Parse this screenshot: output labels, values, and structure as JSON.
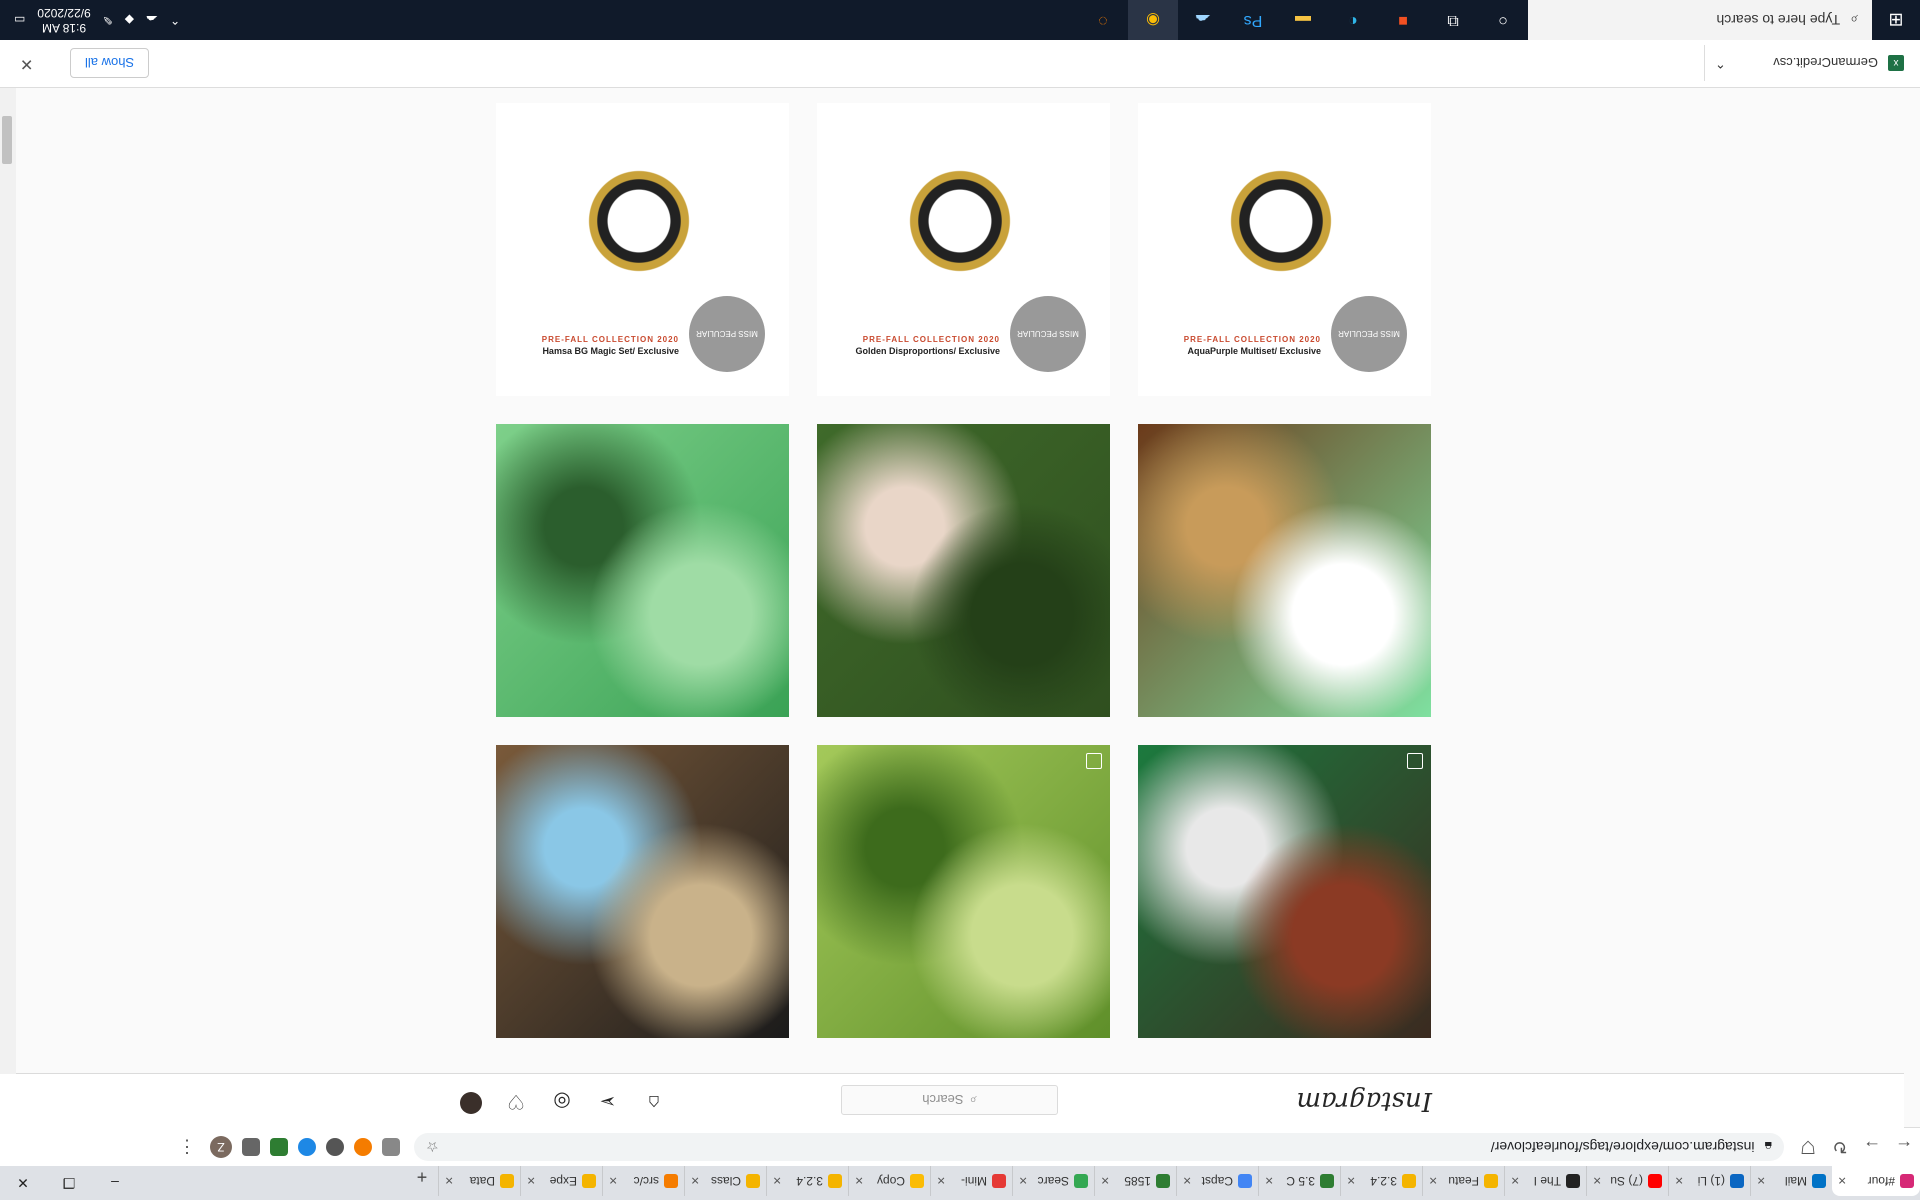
{
  "browser": {
    "tabs": [
      {
        "label": "#four",
        "color": "#d62976",
        "active": true
      },
      {
        "label": "Mail",
        "color": "#0072c6"
      },
      {
        "label": "(1) Li",
        "color": "#0a66c2"
      },
      {
        "label": "(7) Su",
        "color": "#ff0000"
      },
      {
        "label": "The I",
        "color": "#222222"
      },
      {
        "label": "Featu",
        "color": "#f4b400"
      },
      {
        "label": "3.2.4",
        "color": "#f4b400"
      },
      {
        "label": "3.5 C",
        "color": "#2e7d32"
      },
      {
        "label": "Capst",
        "color": "#4285f4"
      },
      {
        "label": "1585",
        "color": "#2e7d32"
      },
      {
        "label": "Searc",
        "color": "#34a853"
      },
      {
        "label": "Mini-",
        "color": "#e53935"
      },
      {
        "label": "Copy",
        "color": "#fbbc05"
      },
      {
        "label": "3.2.4",
        "color": "#f4b400"
      },
      {
        "label": "Class",
        "color": "#f4b400"
      },
      {
        "label": "src/c",
        "color": "#f57c00"
      },
      {
        "label": "Expe",
        "color": "#f4b400"
      },
      {
        "label": "Data",
        "color": "#f4b400"
      }
    ],
    "address": "instagram.com/explore/tags/fourleafclover/",
    "profile_letter": "Z"
  },
  "instagram": {
    "logo": "Instagram",
    "search_placeholder": "Search",
    "icons": [
      "home-icon",
      "direct-icon",
      "explore-icon",
      "heart-icon",
      "profile-avatar"
    ]
  },
  "grid": [
    [
      {
        "kind": "photo",
        "name": "celtic-jersey-selfie",
        "colors": [
          "#3b2a20",
          "#1c7a3e",
          "#e8e8e8",
          "#8b3a24"
        ],
        "multi": true
      },
      {
        "kind": "photo",
        "name": "clover-in-grass",
        "colors": [
          "#5f8f2a",
          "#a4c95a",
          "#3d6b1c",
          "#c8dc8c"
        ],
        "multi": true
      },
      {
        "kind": "photo",
        "name": "bookshelf-figures",
        "colors": [
          "#1b1b1b",
          "#7a5a3a",
          "#8ac7e6",
          "#c9b28a"
        ]
      }
    ],
    [
      {
        "kind": "photo",
        "name": "glass-clover-dish",
        "colors": [
          "#7fe0a0",
          "#6b3a1a",
          "#c89b5a",
          "#ffffff"
        ]
      },
      {
        "kind": "photo",
        "name": "hand-holding-clover",
        "colors": [
          "#2f4f1f",
          "#3f6a2a",
          "#e9d6c8",
          "#244018"
        ]
      },
      {
        "kind": "photo",
        "name": "clover-leaves",
        "colors": [
          "#3aa255",
          "#7ed08a",
          "#2b5e2d",
          "#9fdca5"
        ]
      }
    ],
    [
      {
        "kind": "product",
        "name": "aquapurple-bracelet",
        "title": "AquaPurple Multiset/ Exclusive",
        "sub": "PRE-FALL COLLECTION 2020",
        "badge": "MISS PECULIAR"
      },
      {
        "kind": "product",
        "name": "golden-disproportions-bracelet",
        "title": "Golden Disproportions/ Exclusive",
        "sub": "PRE-FALL COLLECTION 2020",
        "badge": "MISS PECULIAR"
      },
      {
        "kind": "product",
        "name": "hamsa-bracelet",
        "title": "Hamsa BG Magic Set/ Exclusive",
        "sub": "PRE-FALL COLLECTION 2020",
        "badge": "MISS PECULIAR"
      }
    ]
  ],
  "downloads": {
    "file_name": "GermanCredit.csv",
    "show_all": "Show all"
  },
  "taskbar": {
    "search_placeholder": "Type here to search",
    "time": "9:18 AM",
    "date": "9/22/2020"
  }
}
